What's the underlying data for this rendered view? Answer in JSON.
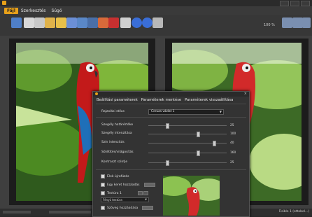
{
  "window": {
    "title": ""
  },
  "menu": {
    "items": [
      "Fájl",
      "Szerkesztés",
      "Súgó"
    ]
  },
  "toolbar": {
    "icons": [
      "open-icon",
      "save-icon",
      "copy-icon",
      "paste-icon",
      "undo-icon",
      "redo-icon",
      "image-icon",
      "image-icon",
      "paint-icon",
      "text-icon",
      "print-icon",
      "info-icon",
      "help-icon",
      "settings-icon",
      "scissors-icon",
      "scissors-icon",
      "scissors-icon"
    ],
    "zoom": "100 %"
  },
  "status": {
    "zoom_text": "Fisible 1 (ottobol...)"
  },
  "dialog": {
    "tabs": [
      "Beállítási paraméterek",
      "Paraméterek mentése",
      "Paraméterek visszaállítása"
    ],
    "style_label": "Rajzolási stílus",
    "style_value": "Ceruza vázlat 1",
    "sliders": [
      {
        "label": "Szegély határértéke",
        "value": "25",
        "level": 0.22
      },
      {
        "label": "Szegély intenzitása",
        "value": "100",
        "level": 0.62
      },
      {
        "label": "Szín intenzitás",
        "value": "40",
        "level": 0.82
      },
      {
        "label": "Sötétítés/világosítás",
        "value": "160",
        "level": 0.62
      },
      {
        "label": "Kontraszt szintje",
        "value": "25",
        "level": 0.22
      }
    ],
    "checks": [
      {
        "label": "Élek újrafúzás",
        "on": false
      },
      {
        "label": "Egy keret hozzáadás",
        "on": false
      },
      {
        "label": "Textúra 1",
        "on": false
      },
      {
        "label": "Szöveg hozzáadása",
        "on": false
      }
    ],
    "texture_select": "Fényű textúra"
  }
}
